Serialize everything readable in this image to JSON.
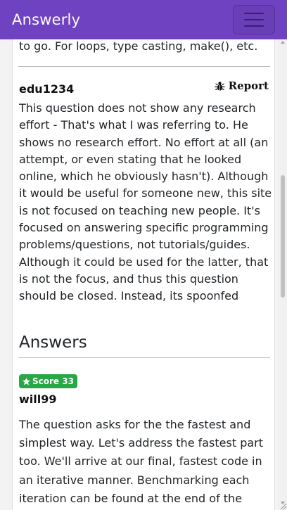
{
  "navbar": {
    "brand": "Answerly",
    "brand_color": "#6f42c1",
    "toggle_icon": "hamburger-menu-icon"
  },
  "question": {
    "tail_text": "to go. For loops, type casting, make(), etc."
  },
  "comment": {
    "user": "edu1234",
    "report_label": "Report",
    "report_icon": "bug-icon",
    "body": "This question does not show any research effort - That's what I was referring to. He shows no research effort. No effort at all (an attempt, or even stating that he looked online, which he obviously hasn't). Although it would be useful for someone new, this site is not focused on teaching new people. It's focused on answering specific programming problems/questions, not tutorials/guides. Although it could be used for the latter, that is not the focus, and thus this question should be closed. Instead, its spoonfed"
  },
  "answers": {
    "title": "Answers",
    "items": [
      {
        "score_label": "Score 33",
        "score_icon": "star-icon",
        "badge_color": "#28a745",
        "user": "will99",
        "body": "The question asks for the the fastest and simplest way. Let's address the fastest part too. We'll arrive at our final, fastest code in an iterative manner. Benchmarking each iteration can be found at the end of the answer. All the"
      }
    ]
  }
}
